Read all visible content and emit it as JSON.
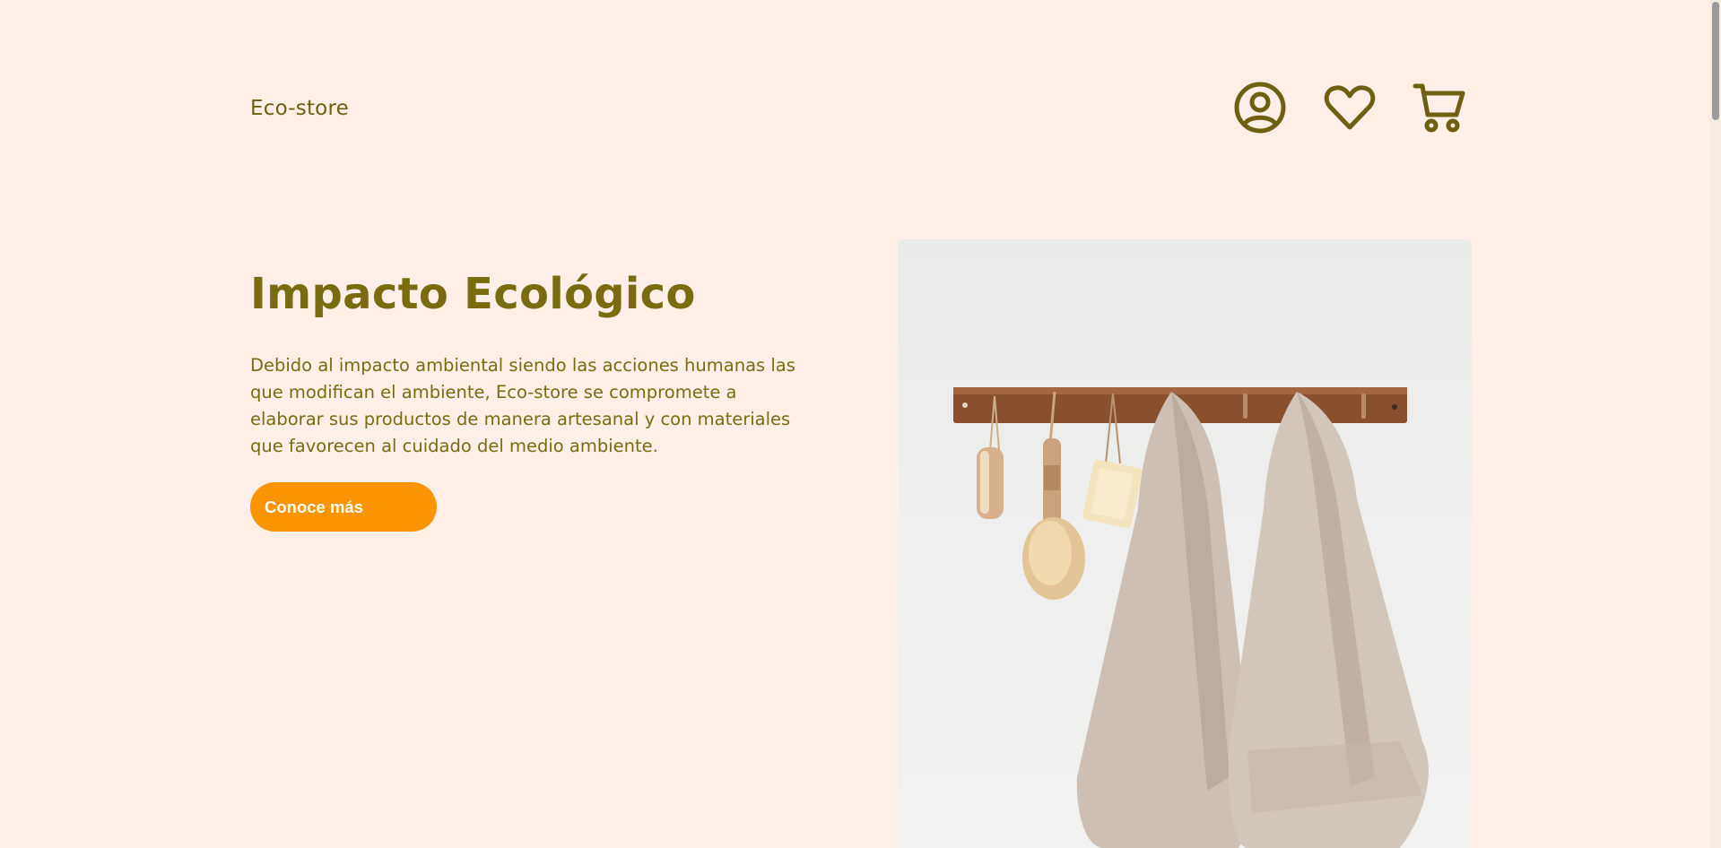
{
  "header": {
    "brand": "Eco-store",
    "icons": [
      "user-circle-icon",
      "heart-icon",
      "cart-icon"
    ]
  },
  "hero": {
    "title": "Impacto Ecológico",
    "description": "Debido al impacto ambiental siendo las acciones humanas las que modifican el ambiente, Eco-store se compromete a elaborar sus productos de manera artesanal y con materiales que favorecen al cuidado del medio ambiente.",
    "cta_label": "Conoce más"
  },
  "colors": {
    "background": "#ffefe6",
    "text": "#7a6a10",
    "accent": "#fa9400",
    "icon": "#6f5f10"
  }
}
